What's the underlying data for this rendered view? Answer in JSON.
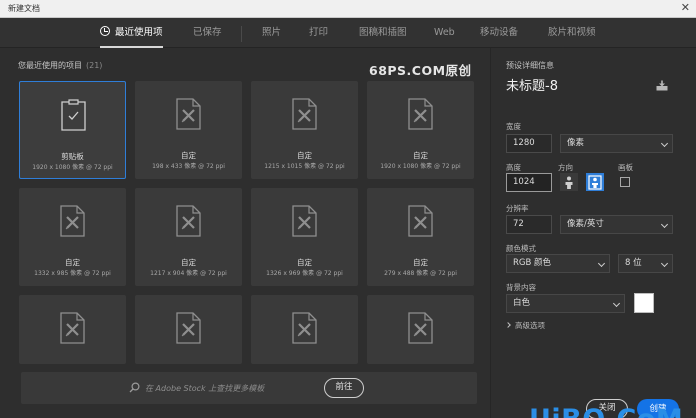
{
  "window": {
    "title": "新建文档",
    "close_label": "✕"
  },
  "tabs": [
    {
      "label": "最近使用项",
      "active": true
    },
    {
      "label": "已保存",
      "active": false
    },
    {
      "label": "照片",
      "active": false
    },
    {
      "label": "打印",
      "active": false
    },
    {
      "label": "图稿和插图",
      "active": false
    },
    {
      "label": "Web",
      "active": false
    },
    {
      "label": "移动设备",
      "active": false
    },
    {
      "label": "胶片和视频",
      "active": false
    }
  ],
  "recent": {
    "title": "您最近使用的项目",
    "count": "(21)",
    "watermark": "68PS.COM原创",
    "items": [
      {
        "name": "剪贴板",
        "meta": "1920 x 1080 像素 @ 72 ppi",
        "icon": "clipboard-icon",
        "selected": true
      },
      {
        "name": "自定",
        "meta": "198 x 433 像素 @ 72 ppi",
        "icon": "custom-doc-icon"
      },
      {
        "name": "自定",
        "meta": "1215 x 1015 像素 @ 72 ppi",
        "icon": "custom-doc-icon"
      },
      {
        "name": "自定",
        "meta": "1920 x 1080 像素 @ 72 ppi",
        "icon": "custom-doc-icon"
      },
      {
        "name": "自定",
        "meta": "1332 x 985 像素 @ 72 ppi",
        "icon": "custom-doc-icon"
      },
      {
        "name": "自定",
        "meta": "1217 x 904 像素 @ 72 ppi",
        "icon": "custom-doc-icon"
      },
      {
        "name": "自定",
        "meta": "1326 x 969 像素 @ 72 ppi",
        "icon": "custom-doc-icon"
      },
      {
        "name": "自定",
        "meta": "279 x 488 像素 @ 72 ppi",
        "icon": "custom-doc-icon"
      },
      {
        "name": "",
        "meta": "",
        "icon": "custom-doc-icon"
      },
      {
        "name": "",
        "meta": "",
        "icon": "custom-doc-icon"
      },
      {
        "name": "",
        "meta": "",
        "icon": "custom-doc-icon"
      },
      {
        "name": "",
        "meta": "",
        "icon": "custom-doc-icon"
      }
    ]
  },
  "stock": {
    "placeholder": "在 Adobe Stock 上查找更多模板",
    "go_label": "前往"
  },
  "details": {
    "header": "预设详细信息",
    "preset_name": "未标题-8",
    "width_label": "宽度",
    "width_value": "1280",
    "width_unit": "像素",
    "height_label": "高度",
    "height_value": "1024",
    "orientation_label": "方向",
    "artboard_label": "画板",
    "resolution_label": "分辨率",
    "resolution_value": "72",
    "resolution_unit": "像素/英寸",
    "color_mode_label": "颜色模式",
    "color_mode_value": "RGB 颜色",
    "bit_depth_value": "8 位",
    "background_label": "背景内容",
    "background_value": "白色",
    "background_color": "#ffffff",
    "advanced_label": "高级选项",
    "close_label": "关闭",
    "create_label": "创建"
  },
  "brand": {
    "text_left": "UiBQ",
    "text_dot": ".",
    "text_right": "CoM"
  },
  "colors": {
    "accent": "#1473e6",
    "selection": "#2f7ed8"
  }
}
